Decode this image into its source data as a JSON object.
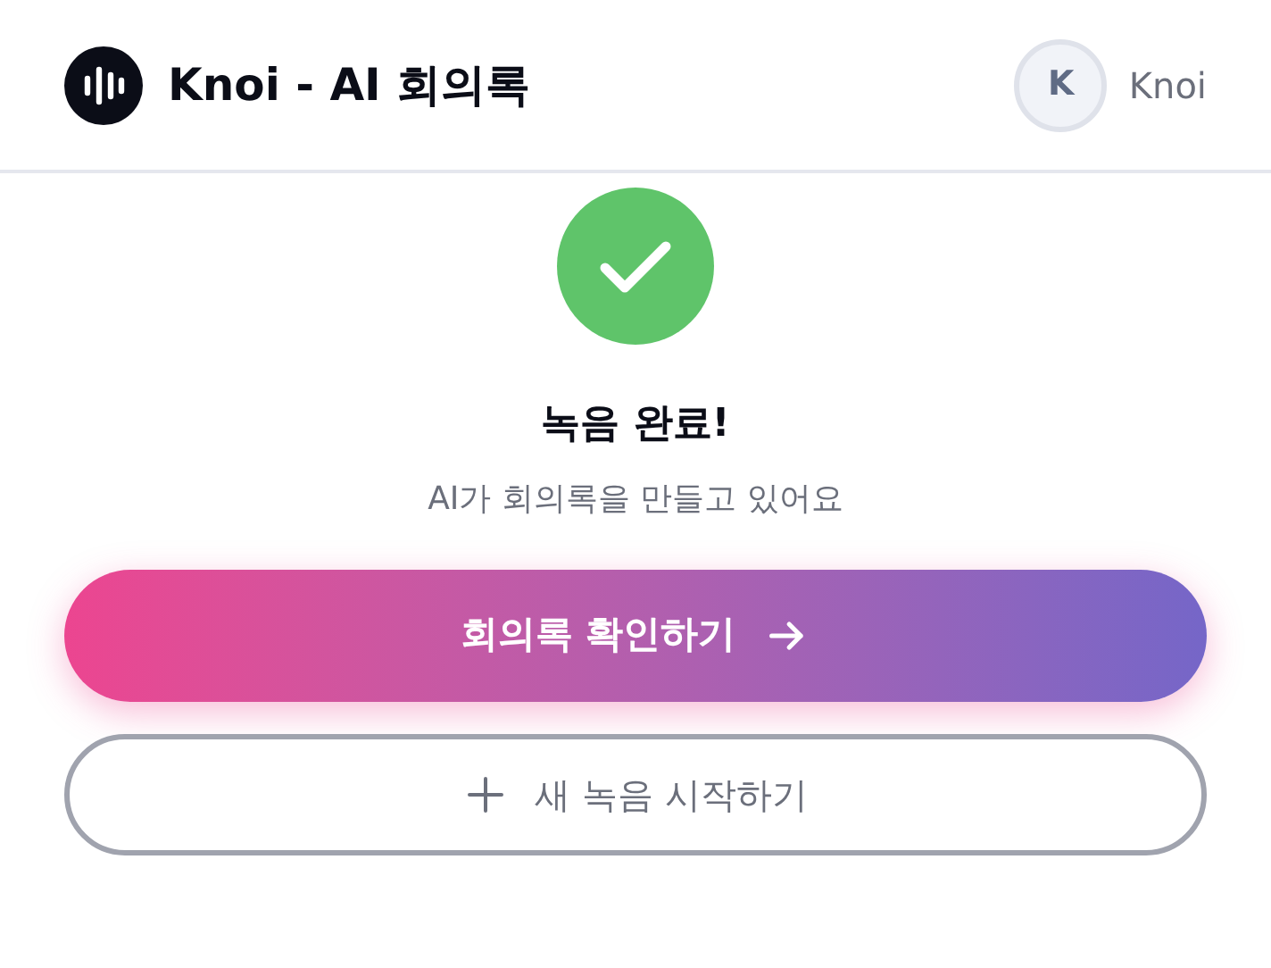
{
  "header": {
    "title": "Knoi - AI 회의록",
    "avatar_initial": "K",
    "user_name": "Knoi"
  },
  "status": {
    "title": "녹음 완료!",
    "subtitle": "AI가 회의록을 만들고 있어요"
  },
  "buttons": [
    {
      "kind": "primary",
      "label": "회의록 확인하기"
    },
    {
      "kind": "secondary",
      "label": "새 녹음 시작하기"
    }
  ]
}
